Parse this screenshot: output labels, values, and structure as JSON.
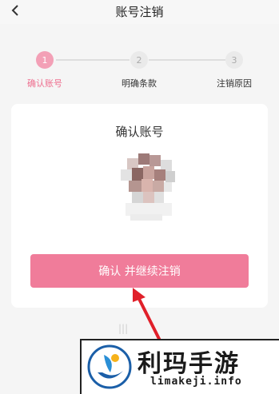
{
  "header": {
    "title": "账号注销",
    "back_icon": "chevron-left-icon"
  },
  "steps": [
    {
      "number": "1",
      "label": "确认账号",
      "active": true
    },
    {
      "number": "2",
      "label": "明确条款",
      "active": false
    },
    {
      "number": "3",
      "label": "注销原因",
      "active": false
    }
  ],
  "card": {
    "title": "确认账号",
    "avatar": "blurred-avatar",
    "confirm_label": "确认 并继续注销"
  },
  "annotation": {
    "arrow": "arrow-pointer-icon"
  },
  "watermark": {
    "cn": "利玛手游",
    "en": "limakeji.info"
  },
  "colors": {
    "accent": "#f07c9a",
    "active_step": "#f3a0b6",
    "background": "#f5f5f5"
  }
}
